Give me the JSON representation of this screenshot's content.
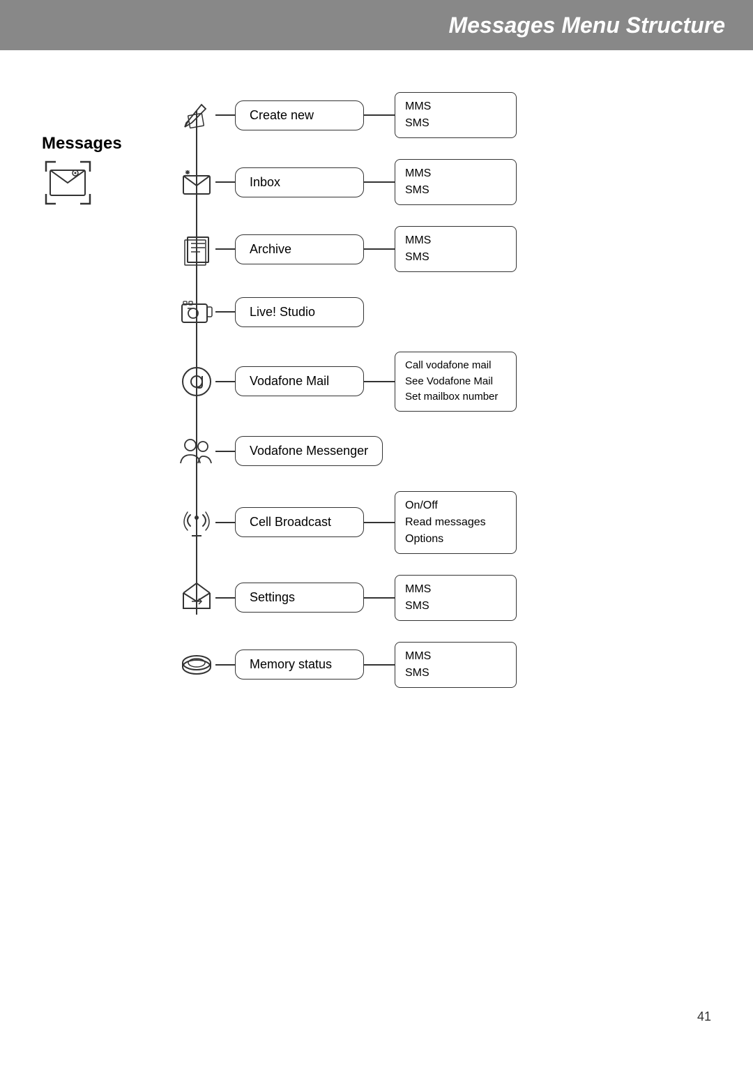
{
  "header": {
    "title": "Messages Menu Structure",
    "bg_color": "#888888"
  },
  "left_label": {
    "title": "Messages"
  },
  "menu_items": [
    {
      "id": "create-new",
      "label": "Create new",
      "sub_items": [
        "MMS",
        "SMS"
      ],
      "has_sub": true
    },
    {
      "id": "inbox",
      "label": "Inbox",
      "sub_items": [
        "MMS",
        "SMS"
      ],
      "has_sub": true
    },
    {
      "id": "archive",
      "label": "Archive",
      "sub_items": [
        "MMS",
        "SMS"
      ],
      "has_sub": true
    },
    {
      "id": "live-studio",
      "label": "Live! Studio",
      "sub_items": [],
      "has_sub": false
    },
    {
      "id": "vodafone-mail",
      "label": "Vodafone Mail",
      "sub_items": [
        "Call vodafone mail",
        "See Vodafone Mail",
        "Set mailbox number"
      ],
      "has_sub": true
    },
    {
      "id": "vodafone-messenger",
      "label": "Vodafone Messenger",
      "sub_items": [],
      "has_sub": false
    },
    {
      "id": "cell-broadcast",
      "label": "Cell Broadcast",
      "sub_items": [
        "On/Off",
        "Read messages",
        "Options"
      ],
      "has_sub": true
    },
    {
      "id": "settings",
      "label": "Settings",
      "sub_items": [
        "MMS",
        "SMS"
      ],
      "has_sub": true
    },
    {
      "id": "memory-status",
      "label": "Memory status",
      "sub_items": [
        "MMS",
        "SMS"
      ],
      "has_sub": true
    }
  ],
  "page_number": "41"
}
